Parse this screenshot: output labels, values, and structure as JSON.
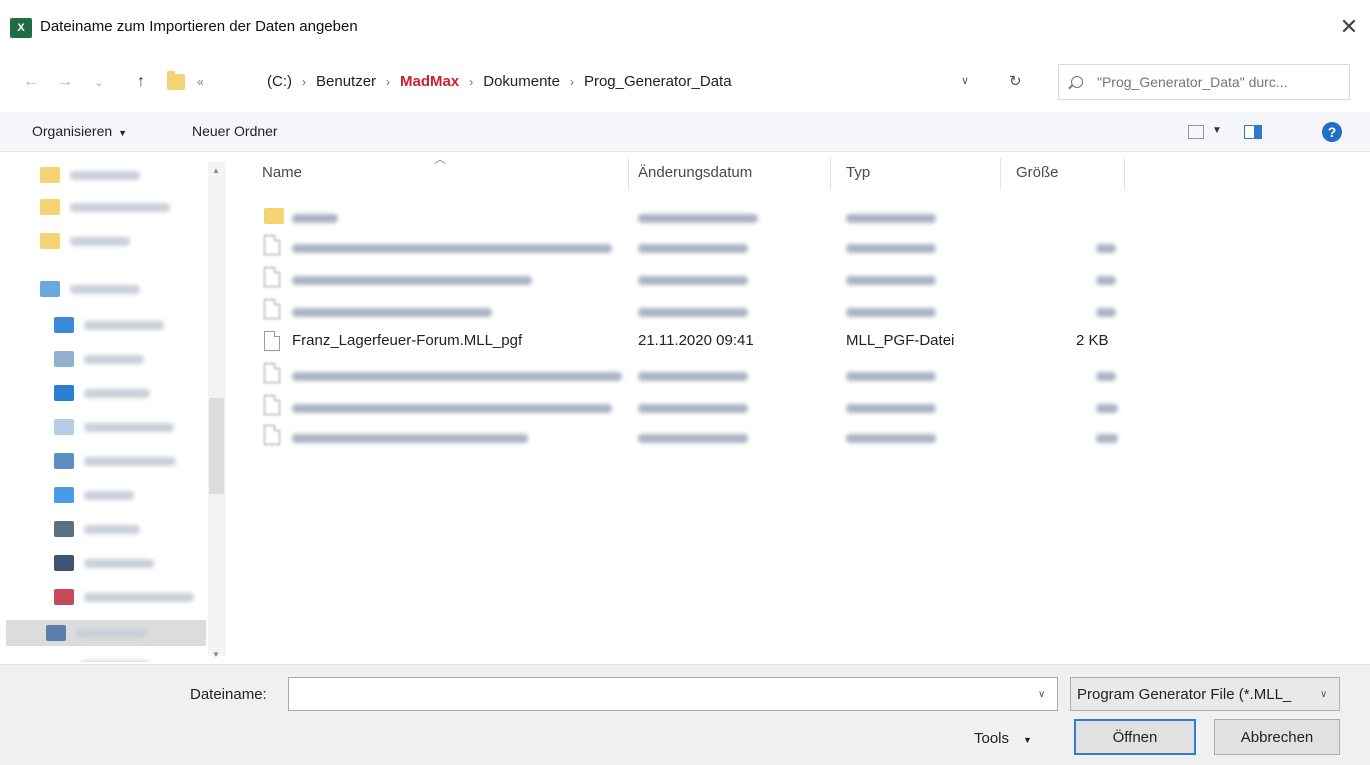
{
  "window": {
    "title": "Dateiname zum Importieren der Daten angeben",
    "app_icon": "X",
    "close": "✕"
  },
  "nav": {
    "back": "←",
    "forward": "→",
    "recent": "⌄",
    "up": "↑",
    "overflow": "«",
    "breadcrumbs": [
      "(C:)",
      "Benutzer",
      "MadMax",
      "Dokumente",
      "Prog_Generator_Data"
    ],
    "crumb_separator": "›",
    "search_placeholder": "\"Prog_Generator_Data\" durc..."
  },
  "toolbar": {
    "organize": "Organisieren",
    "new_folder": "Neuer Ordner",
    "help": "?"
  },
  "columns": {
    "name": "Name",
    "modified": "Änderungsdatum",
    "type": "Typ",
    "size": "Größe"
  },
  "files": [
    {
      "name": "Franz_Lagerfeuer-Forum.MLL_pgf",
      "modified": "21.11.2020 09:41",
      "type": "MLL_PGF-Datei",
      "size": "2 KB"
    }
  ],
  "footer": {
    "filename_label": "Dateiname:",
    "filename_value": "",
    "filetype": "Program Generator File (*.MLL_",
    "tools": "Tools",
    "open": "Öffnen",
    "cancel": "Abbrechen"
  },
  "icons": {
    "accent": "#1e6fc5",
    "folder": "#f4d374",
    "excel": "#1d6f42",
    "breadcrumb_highlight": "#d0202e"
  }
}
